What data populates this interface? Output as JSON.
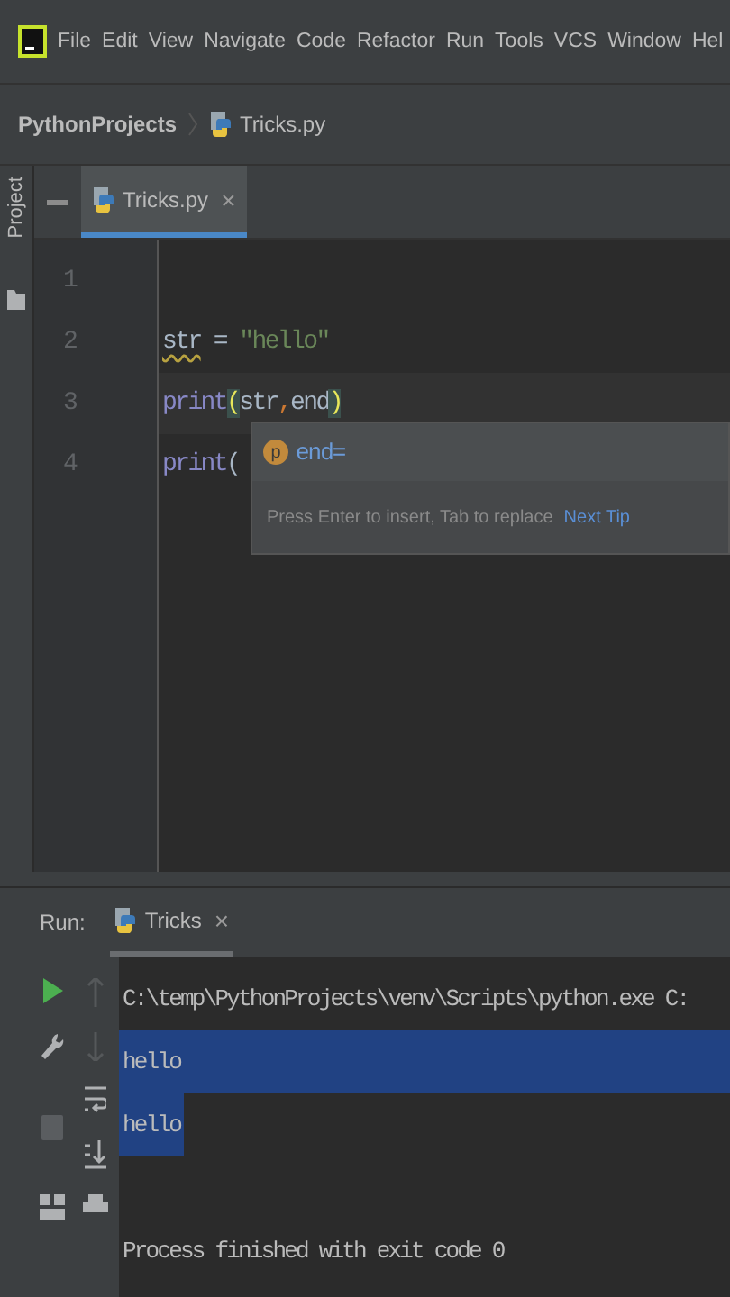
{
  "menu_bar": {
    "items": [
      "File",
      "Edit",
      "View",
      "Navigate",
      "Code",
      "Refactor",
      "Run",
      "Tools",
      "VCS",
      "Window",
      "Hel"
    ]
  },
  "breadcrumb": {
    "project": "PythonProjects",
    "file": "Tricks.py"
  },
  "side_strip": {
    "label": "Project"
  },
  "editor_tabs": [
    {
      "label": "Tricks.py",
      "selected": true,
      "close": "×"
    }
  ],
  "editor": {
    "lines": [
      {
        "number": "1"
      },
      {
        "number": "2",
        "tokens": [
          {
            "kind": "warn",
            "text": "str"
          },
          {
            "kind": "plain",
            "text": " = "
          },
          {
            "kind": "string",
            "text": "\"hello\""
          }
        ]
      },
      {
        "number": "3",
        "tokens": [
          {
            "kind": "builtin",
            "text": "print"
          },
          {
            "kind": "paren",
            "text": "("
          },
          {
            "kind": "plain",
            "text": "str"
          },
          {
            "kind": "punct",
            "text": ","
          },
          {
            "kind": "plain",
            "text": "end"
          },
          {
            "kind": "paren",
            "text": ")"
          }
        ]
      },
      {
        "number": "4",
        "tokens": [
          {
            "kind": "builtin",
            "text": "print"
          },
          {
            "kind": "plain",
            "text": "("
          }
        ]
      }
    ]
  },
  "completion": {
    "badge": "p",
    "item": "end=",
    "hint": "Press Enter to insert, Tab to replace",
    "link": "Next Tip"
  },
  "run_panel": {
    "label": "Run:",
    "tab": {
      "label": "Tricks",
      "close": "×"
    },
    "output": [
      {
        "text": "C:\\temp\\PythonProjects\\venv\\Scripts\\python.exe C:",
        "selected": false
      },
      {
        "text": "hello",
        "selected": true
      },
      {
        "text": "hello",
        "selected": true
      },
      {
        "text": "Process finished with exit code 0",
        "selected": false
      }
    ]
  }
}
